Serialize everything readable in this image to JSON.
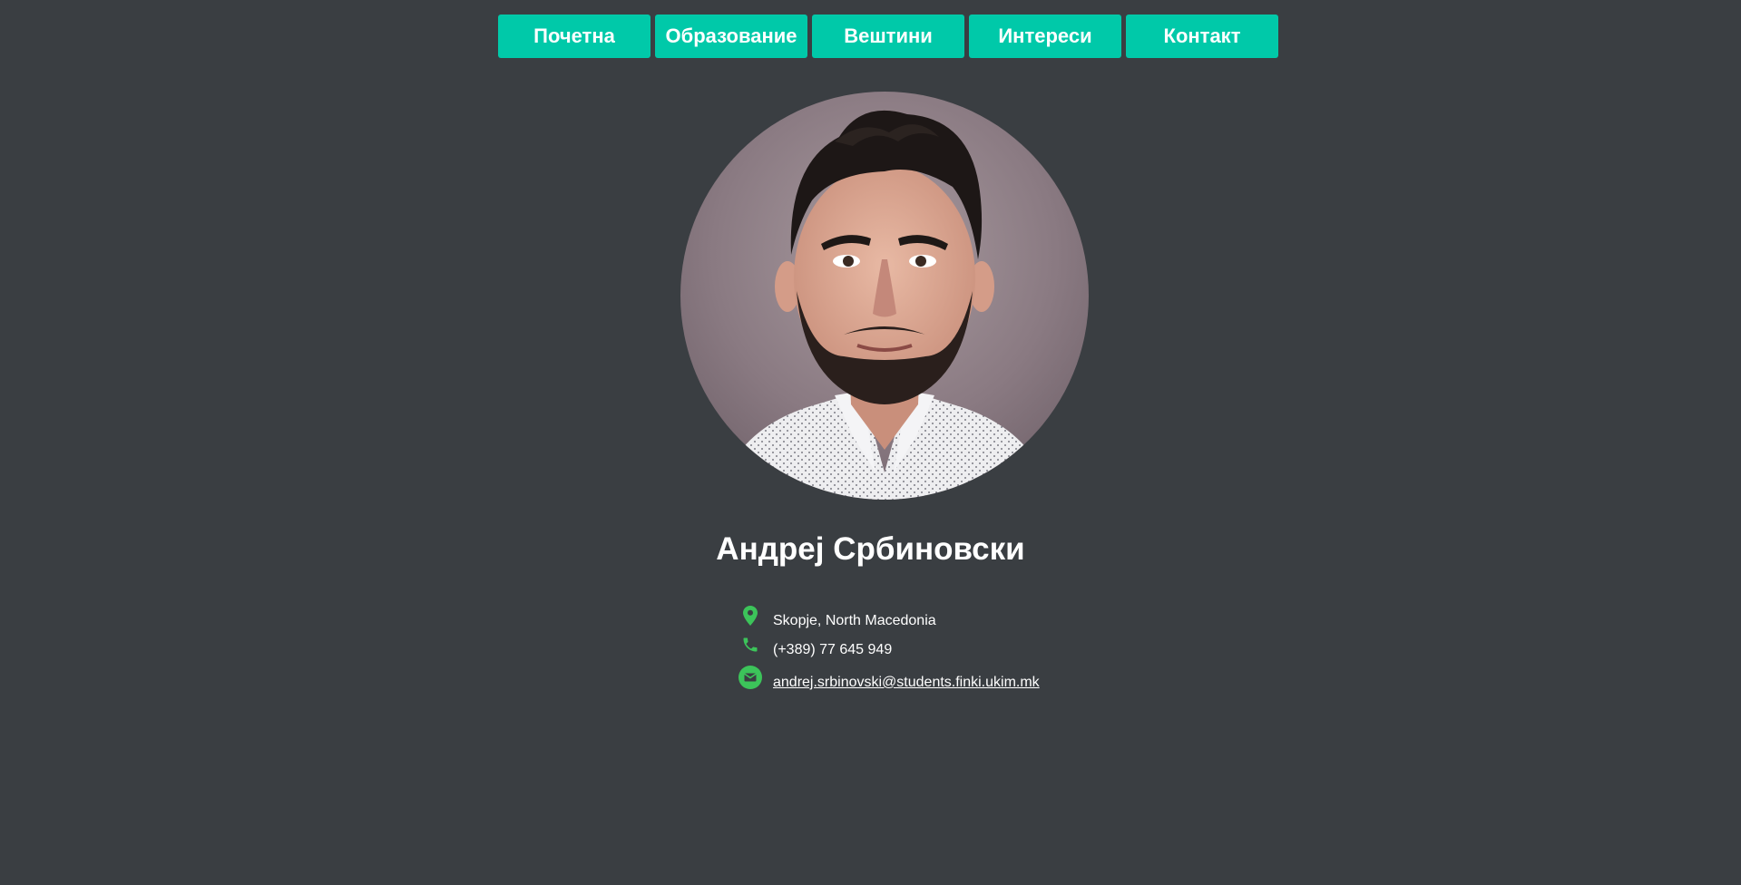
{
  "nav": {
    "items": [
      {
        "label": "Почетна"
      },
      {
        "label": "Образование"
      },
      {
        "label": "Вештини"
      },
      {
        "label": "Интереси"
      },
      {
        "label": "Контакт"
      }
    ]
  },
  "profile": {
    "name": "Андреј Србиновски"
  },
  "contact": {
    "location": "Skopje, North Macedonia",
    "phone": "(+389) 77 645 949",
    "email": "andrej.srbinovski@students.finki.ukim.mk"
  },
  "colors": {
    "background": "#3a3e42",
    "accent": "#00c9a9",
    "icon": "#3cc45a"
  },
  "icons": {
    "location": "map-pin-icon",
    "phone": "phone-icon",
    "email": "envelope-icon"
  }
}
